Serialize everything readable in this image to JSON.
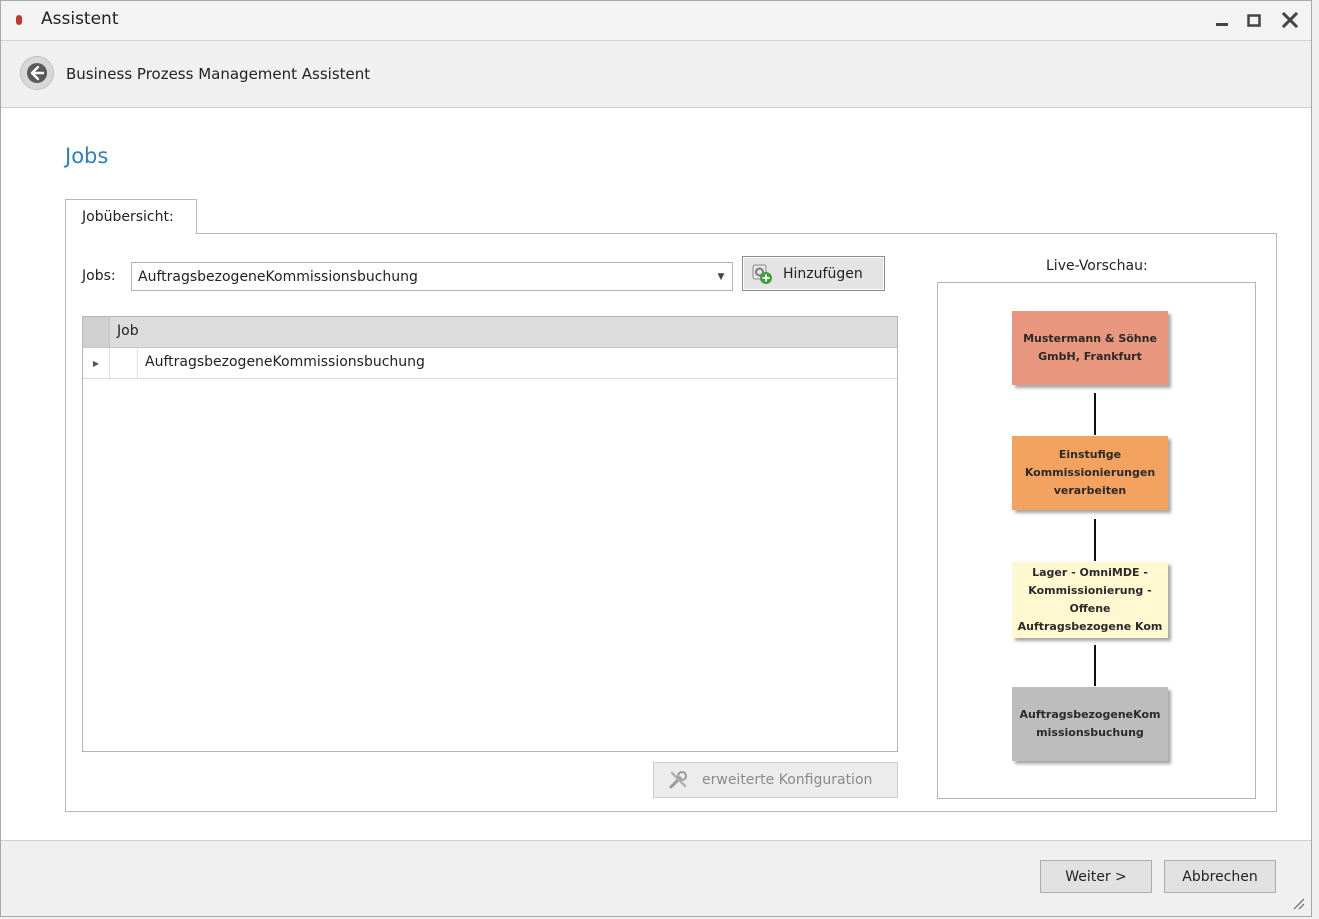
{
  "window": {
    "title": "Assistent",
    "controls": {
      "minimize": "_",
      "maximize": "□",
      "close": "✕"
    },
    "app_icon": "app-logo-icon"
  },
  "header": {
    "title": "Business Prozess Management Assistent",
    "back_icon": "back-arrow-icon"
  },
  "content": {
    "section_title": "Jobs",
    "tab_label": "Jobübersicht:",
    "jobs": {
      "label": "Jobs:",
      "selected": "AuftragsbezogeneKommissionsbuchung",
      "add_button": "Hinzufügen",
      "add_icon": "add-job-icon"
    },
    "grid": {
      "column_header": "Job",
      "rows": [
        "AuftragsbezogeneKommissionsbuchung"
      ]
    },
    "extended_config_button": "erweiterte Konfiguration",
    "extended_config_icon": "tools-icon"
  },
  "preview": {
    "label": "Live-Vorschau:",
    "nodes": [
      {
        "lines": [
          "Mustermann & Söhne",
          "GmbH, Frankfurt"
        ],
        "color": "#e8967d"
      },
      {
        "lines": [
          "Einstufige",
          "Kommissionierungen",
          "verarbeiten"
        ],
        "color": "#f4a25f"
      },
      {
        "lines": [
          "Lager - OmniMDE -",
          "Kommissionierung -",
          "Offene",
          "Auftragsbezogene Kom"
        ],
        "color": "#fff8d0"
      },
      {
        "lines": [
          "AuftragsbezogeneKom",
          "missionsbuchung"
        ],
        "color": "#bdbdbd"
      }
    ]
  },
  "footer": {
    "next_button": "Weiter >",
    "cancel_button": "Abbrechen"
  }
}
